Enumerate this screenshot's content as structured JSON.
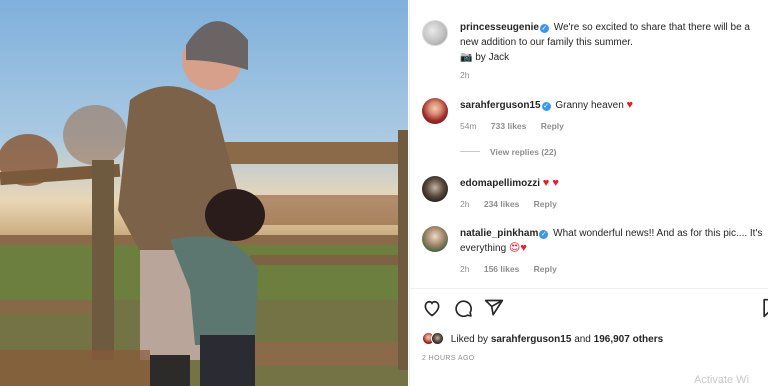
{
  "post": {
    "author": "princesseugenie",
    "caption": "We're so excited to share that there will be a new addition to our family this summer.",
    "credit": "📷 by Jack",
    "time": "2h"
  },
  "comments": [
    {
      "user": "sarahferguson15",
      "text": "Granny heaven",
      "emoji": "♥",
      "time": "54m",
      "likes": "733 likes",
      "reply": "Reply"
    },
    {
      "user": "edomapellimozzi",
      "text": "",
      "emoji": "♥ ♥",
      "time": "2h",
      "likes": "234 likes",
      "reply": "Reply"
    },
    {
      "user": "natalie_pinkham",
      "text": "What wonderful news!! And as for this pic.... It's everything",
      "emoji": "😍♥",
      "time": "2h",
      "likes": "156 likes",
      "reply": "Reply"
    }
  ],
  "view_replies": "View replies (22)",
  "likes_line": {
    "prefix": "Liked by",
    "user": "sarahferguson15",
    "middle": "and",
    "count": "196,907 others"
  },
  "time_ago": "2 HOURS AGO",
  "watermark": "Activate Wi",
  "icons": [
    "heart-icon",
    "comment-icon",
    "share-icon",
    "bookmark-icon"
  ],
  "colors": {
    "verified": "#3897f0",
    "heart": "#ed1b24",
    "meta": "#8e8e8e"
  }
}
